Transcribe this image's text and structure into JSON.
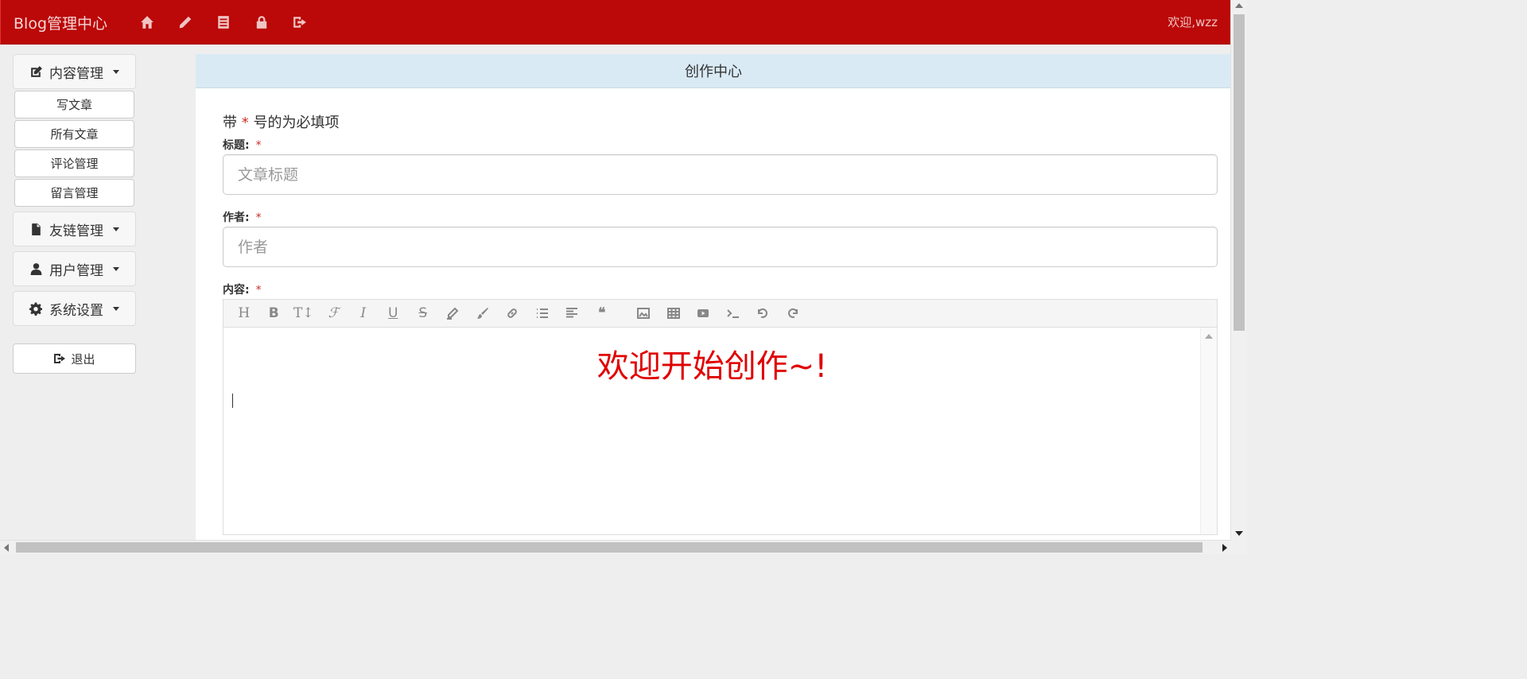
{
  "navbar": {
    "brand": "Blog管理中心",
    "icons": [
      "home-icon",
      "pencil-icon",
      "list-icon",
      "lock-icon",
      "logout-icon"
    ],
    "welcome": "欢迎,wzz",
    "bg_color": "#bb0808"
  },
  "sidebar": {
    "groups": [
      {
        "label": "内容管理",
        "icon": "edit-icon",
        "expanded": true,
        "items": [
          "写文章",
          "所有文章",
          "评论管理",
          "留言管理"
        ]
      },
      {
        "label": "友链管理",
        "icon": "file-icon",
        "expanded": false,
        "items": []
      },
      {
        "label": "用户管理",
        "icon": "user-icon",
        "expanded": false,
        "items": []
      },
      {
        "label": "系统设置",
        "icon": "gear-icon",
        "expanded": false,
        "items": []
      }
    ],
    "logout_label": "退出"
  },
  "main": {
    "header": "创作中心",
    "hint_prefix": "带",
    "hint_star": "*",
    "hint_suffix": "号的为必填项",
    "title_label": "标题:",
    "title_placeholder": "文章标题",
    "author_label": "作者:",
    "author_placeholder": "作者",
    "content_label": "内容:",
    "required_mark": "*",
    "editor_welcome": "欢迎开始创作~!",
    "toolbar": [
      "heading",
      "bold",
      "text-size",
      "font",
      "italic",
      "underline",
      "strikethrough",
      "highlighter",
      "brush",
      "link",
      "unordered-list",
      "align-left",
      "quote",
      "image",
      "table",
      "video",
      "code",
      "undo",
      "redo"
    ]
  }
}
